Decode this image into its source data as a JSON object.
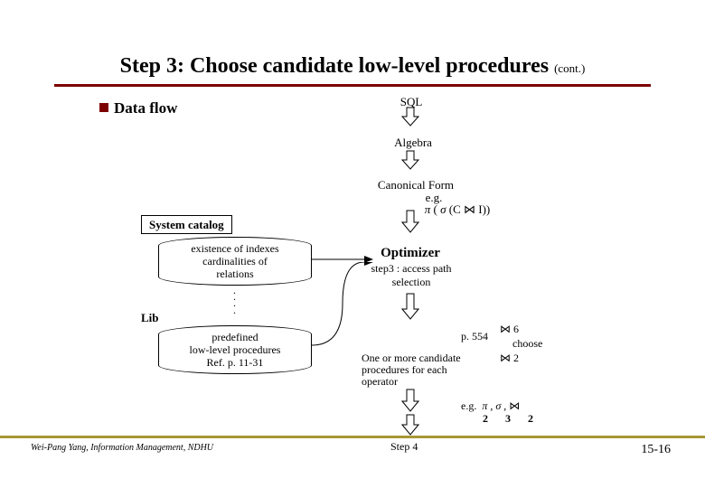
{
  "title": "Step 3: Choose candidate low-level procedures",
  "title_cont": "(cont.)",
  "bullet": "Data flow",
  "flow": {
    "sql": "SQL",
    "algebra": "Algebra",
    "canonical": "Canonical Form",
    "eg_label": "e.g.",
    "eg_expr": "π ( σ (C ⋈ I))",
    "optimizer": "Optimizer",
    "opt_sub": "step3 : access path selection",
    "p554": "p. 554",
    "cand": "One or more candidate procedures for each operator",
    "join6": "6",
    "choose": "choose",
    "join2": "2",
    "eg2_label": "e.g.",
    "eg2_ops": "π , σ , ⋈",
    "eg2_nums": "2 3 2",
    "step4": "Step 4"
  },
  "syscat": {
    "header": "System catalog",
    "card1_l1": "existence of indexes",
    "card1_l2": "cardinalities of",
    "card1_l3": "relations",
    "lib": "Lib",
    "card2_l1": "predefined",
    "card2_l2": "low-level procedures",
    "card2_l3": "Ref. p. 11-31"
  },
  "footer": {
    "left": "Wei-Pang Yang, Information Management, NDHU",
    "right": "15-16"
  }
}
